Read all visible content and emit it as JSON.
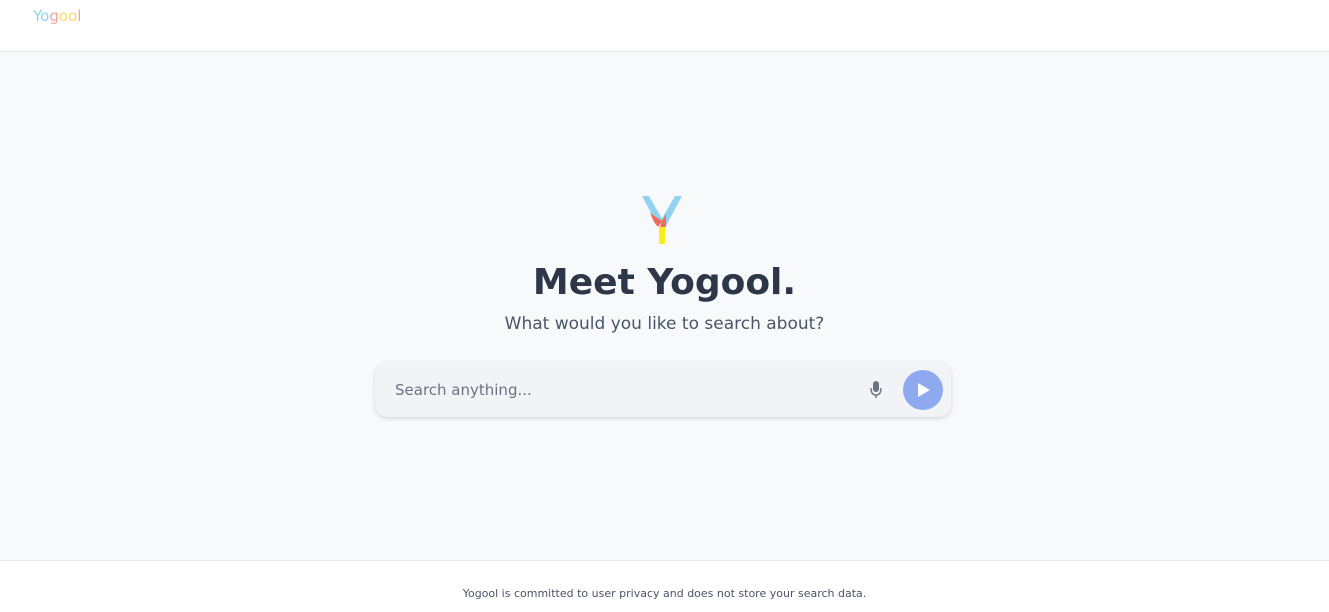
{
  "header": {
    "logo_letters": [
      "Y",
      "o",
      "g",
      "o",
      "o",
      "l"
    ],
    "logo_colors": [
      "#8fd3ee",
      "#8fd3ee",
      "#f4a3a3",
      "#fad86b",
      "#fad86b",
      "#f4a3a3"
    ]
  },
  "hero": {
    "mark_icon": "yogool-y-logo-icon",
    "mark_colors": {
      "left_arm": "#f26b5b",
      "right_arm": "#8fd3ee",
      "stem": "#f7ef1a"
    },
    "title": "Meet Yogool.",
    "subtitle": "What would you like to search about?"
  },
  "search": {
    "placeholder": "Search anything...",
    "value": "",
    "mic_icon": "microphone-icon",
    "send_icon": "play-icon",
    "send_color": "#8fa9f1"
  },
  "footer": {
    "privacy_text": "Yogool is committed to user privacy and does not store your search data."
  }
}
